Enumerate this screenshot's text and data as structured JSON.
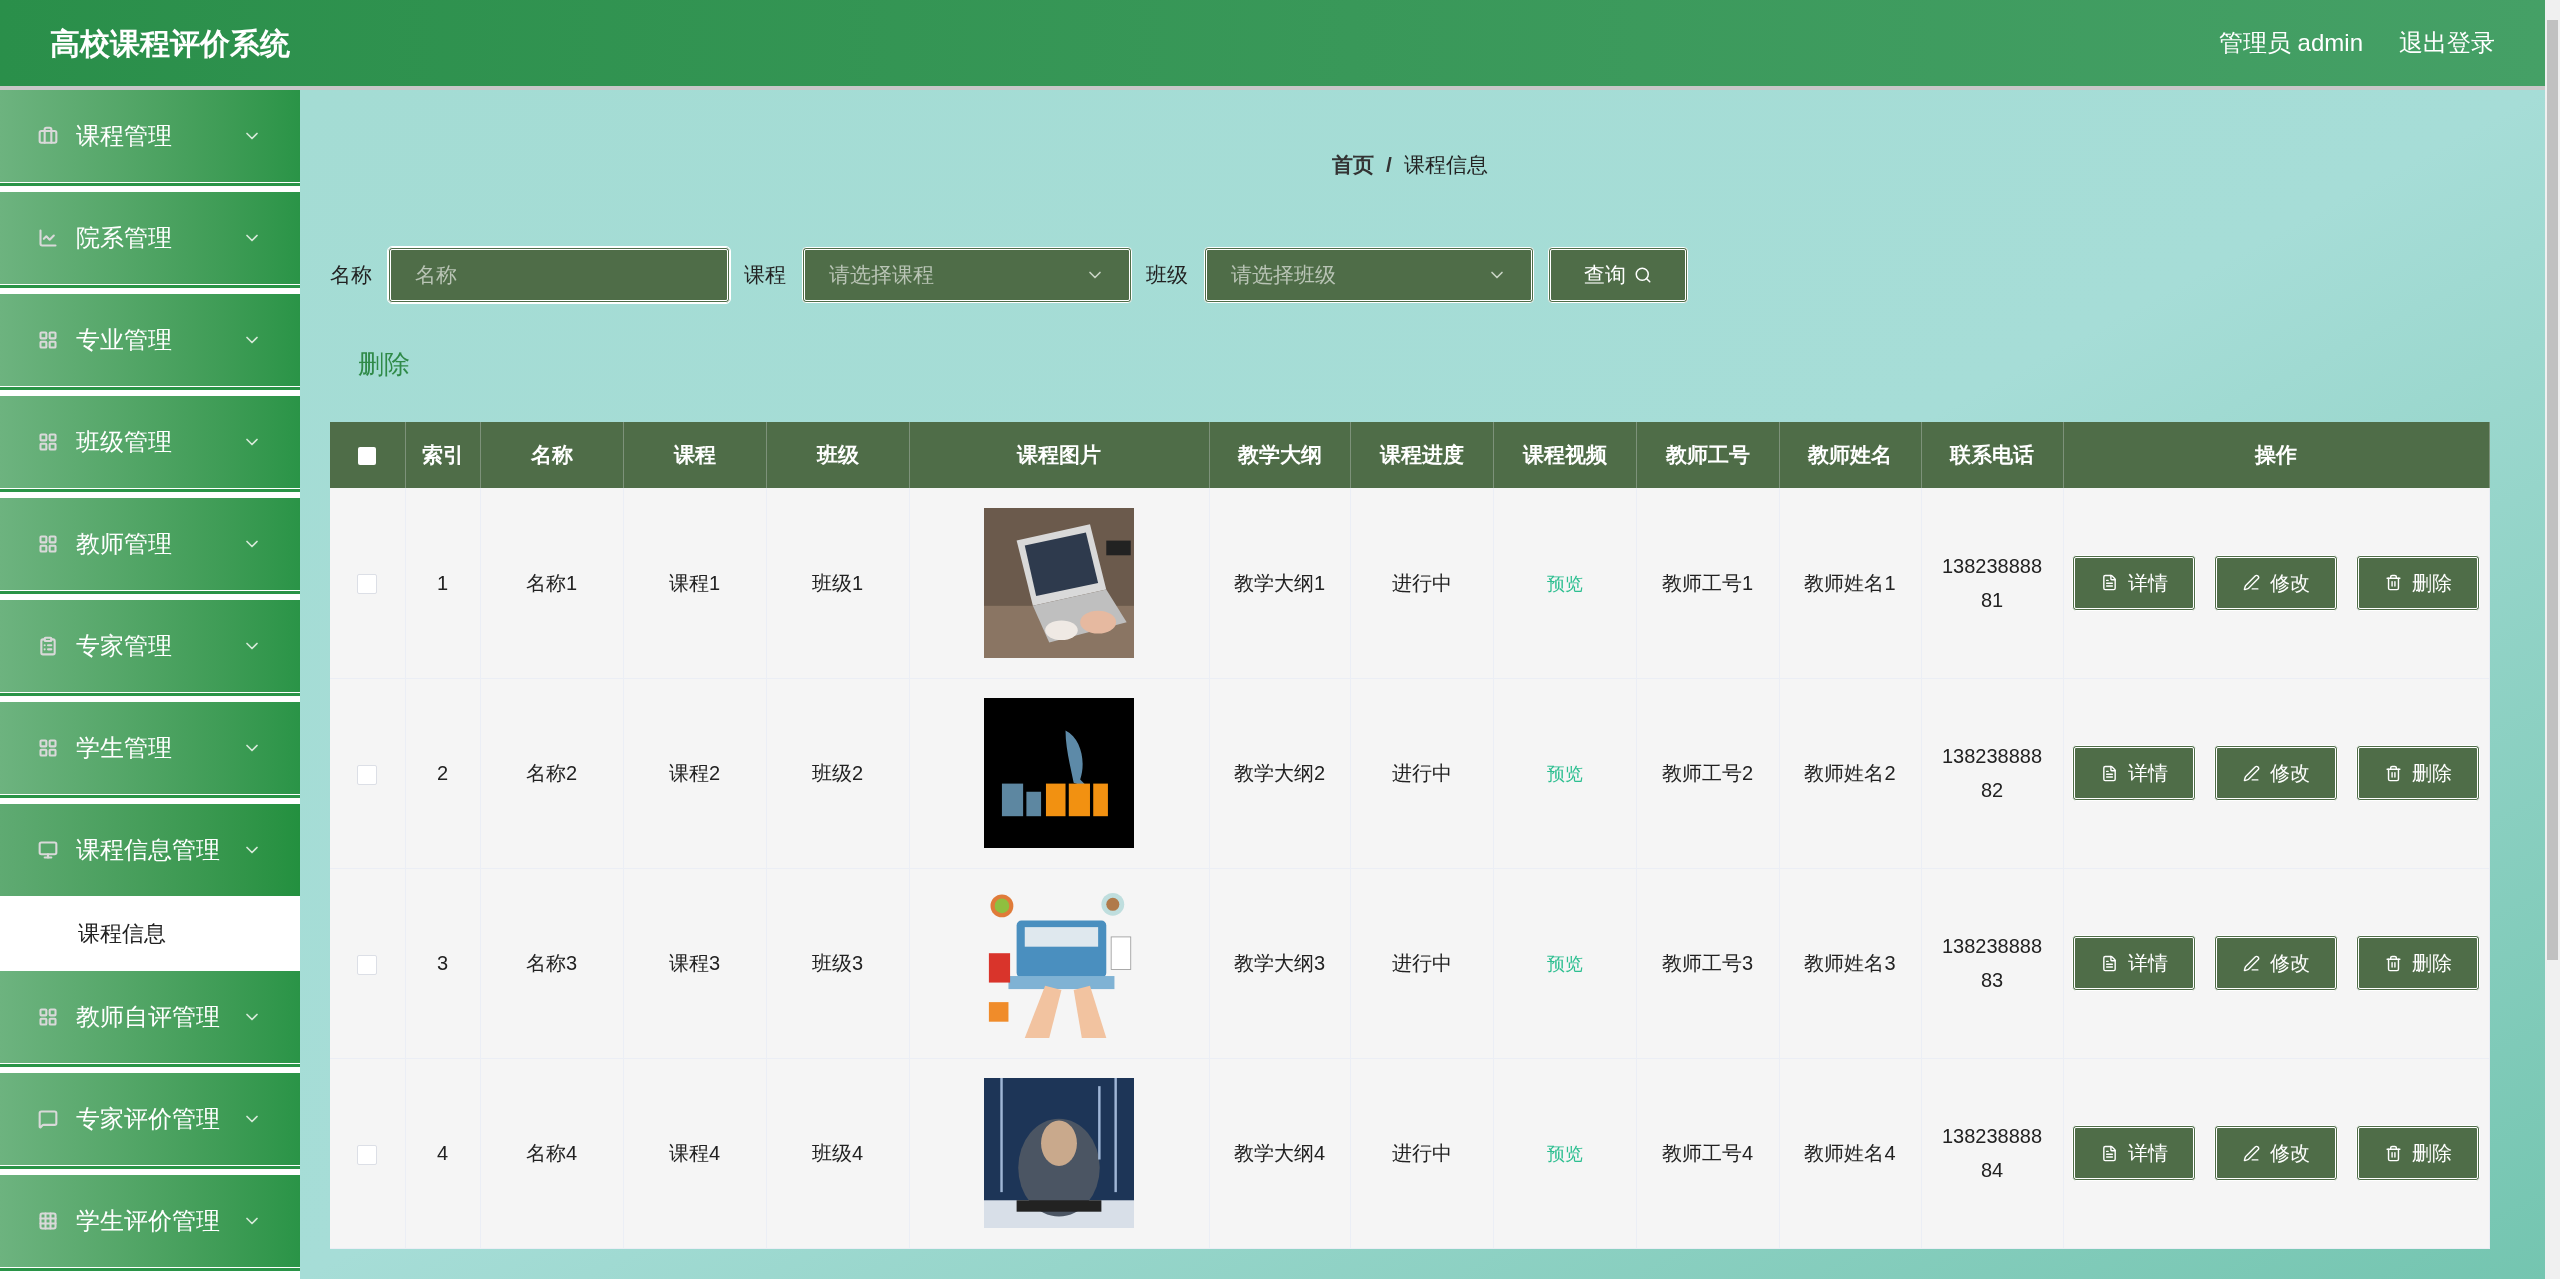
{
  "header": {
    "title": "高校课程评价系统",
    "user": "管理员 admin",
    "logout": "退出登录"
  },
  "sidebar": [
    {
      "label": "课程管理",
      "expanded": false
    },
    {
      "label": "院系管理",
      "expanded": false
    },
    {
      "label": "专业管理",
      "expanded": false
    },
    {
      "label": "班级管理",
      "expanded": false
    },
    {
      "label": "教师管理",
      "expanded": false
    },
    {
      "label": "专家管理",
      "expanded": false
    },
    {
      "label": "学生管理",
      "expanded": false
    },
    {
      "label": "课程信息管理",
      "expanded": true,
      "children": [
        {
          "label": "课程信息"
        }
      ]
    },
    {
      "label": "教师自评管理",
      "expanded": false
    },
    {
      "label": "专家评价管理",
      "expanded": false
    },
    {
      "label": "学生评价管理",
      "expanded": false
    }
  ],
  "breadcrumb": [
    "首页",
    "/",
    "课程信息"
  ],
  "search": [
    {
      "label": "名称",
      "kind": "input",
      "placeholder": "名称"
    },
    {
      "label": "课程",
      "kind": "select",
      "placeholder": "请选择课程"
    },
    {
      "label": "班级",
      "kind": "select",
      "placeholder": "请选择班级"
    }
  ],
  "query_button": "查询",
  "delete_link": "删除",
  "table": {
    "select_all": {
      "checked": false
    },
    "columns": [
      "索引",
      "名称",
      "课程",
      "班级",
      "课程图片",
      "教学大纲",
      "课程进度",
      "课程视频",
      "教师工号",
      "教师姓名",
      "联系电话",
      "操作"
    ],
    "rows": [
      {
        "checked": false,
        "index": "1",
        "name": "名称1",
        "course": "课程1",
        "class": "班级1",
        "syllabus": "教学大纲1",
        "progress": "进行中",
        "video": "预览",
        "teacher_id": "教师工号1",
        "teacher_name": "教师姓名1",
        "phone": "13823888881",
        "actions": [
          "详情",
          "修改",
          "删除"
        ]
      },
      {
        "checked": false,
        "index": "2",
        "name": "名称2",
        "course": "课程2",
        "class": "班级2",
        "syllabus": "教学大纲2",
        "progress": "进行中",
        "video": "预览",
        "teacher_id": "教师工号2",
        "teacher_name": "教师姓名2",
        "phone": "13823888882",
        "actions": [
          "详情",
          "修改",
          "删除"
        ]
      },
      {
        "checked": false,
        "index": "3",
        "name": "名称3",
        "course": "课程3",
        "class": "班级3",
        "syllabus": "教学大纲3",
        "progress": "进行中",
        "video": "预览",
        "teacher_id": "教师工号3",
        "teacher_name": "教师姓名3",
        "phone": "13823888883",
        "actions": [
          "详情",
          "修改",
          "删除"
        ]
      },
      {
        "checked": false,
        "index": "4",
        "name": "名称4",
        "course": "课程4",
        "class": "班级4",
        "syllabus": "教学大纲4",
        "progress": "进行中",
        "video": "预览",
        "teacher_id": "教师工号4",
        "teacher_name": "教师姓名4",
        "phone": "13823888884",
        "actions": [
          "详情",
          "修改",
          "删除"
        ]
      }
    ]
  }
}
